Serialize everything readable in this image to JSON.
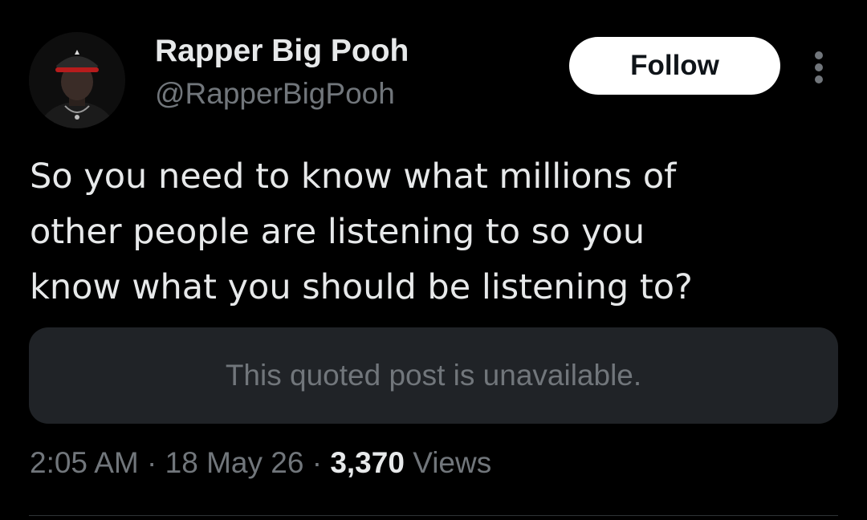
{
  "author": {
    "display_name": "Rapper Big Pooh",
    "handle": "@RapperBigPooh"
  },
  "follow_button": {
    "label": "Follow"
  },
  "more_menu": {
    "icon": "more-vertical-icon"
  },
  "tweet": {
    "text_lines": [
      "So you need to know what millions of",
      "other people are listening to so you",
      "know what you should be listening to?"
    ]
  },
  "quote": {
    "text": "This quoted post is unavailable."
  },
  "meta": {
    "time": "2:05 AM",
    "date": "18 May 26",
    "separator": "·",
    "views_count": "3,370",
    "views_label": "Views"
  },
  "colors": {
    "background": "#000000",
    "primary_text": "#e7e9ea",
    "secondary_text": "#71767b",
    "quote_background": "#202327",
    "follow_background": "#ffffff"
  }
}
